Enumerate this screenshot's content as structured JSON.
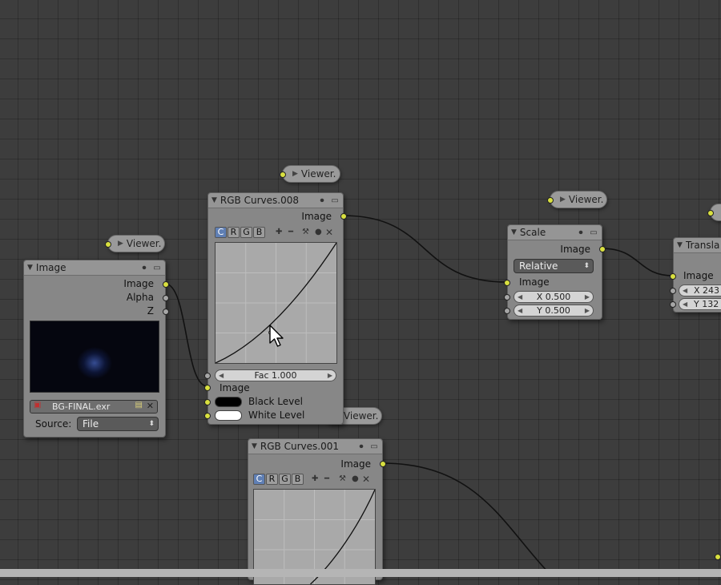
{
  "viewer_label": "Viewer.",
  "image_node": {
    "title": "Image",
    "outputs": [
      "Image",
      "Alpha",
      "Z"
    ],
    "file_name": "BG-FINAL.exr",
    "source_label": "Source:",
    "source_value": "File"
  },
  "curves_a": {
    "title": "RGB Curves.008",
    "output": "Image",
    "channels": [
      "C",
      "R",
      "G",
      "B"
    ],
    "fac": "Fac 1.000",
    "inputs": [
      "Image",
      "Black Level",
      "White Level"
    ]
  },
  "curves_b": {
    "title": "RGB Curves.001",
    "output": "Image",
    "channels": [
      "C",
      "R",
      "G",
      "B"
    ]
  },
  "scale_node": {
    "title": "Scale",
    "output": "Image",
    "space": "Relative",
    "input": "Image",
    "x": "X 0.500",
    "y": "Y 0.500"
  },
  "translate_node": {
    "title": "Transla",
    "input": "Image",
    "x": "X 243",
    "y": "Y 132"
  },
  "colors": {
    "socket_color": "#d9e040",
    "black_level": "#000000",
    "white_level": "#ffffff",
    "active_channel": "#5f7fb4"
  }
}
